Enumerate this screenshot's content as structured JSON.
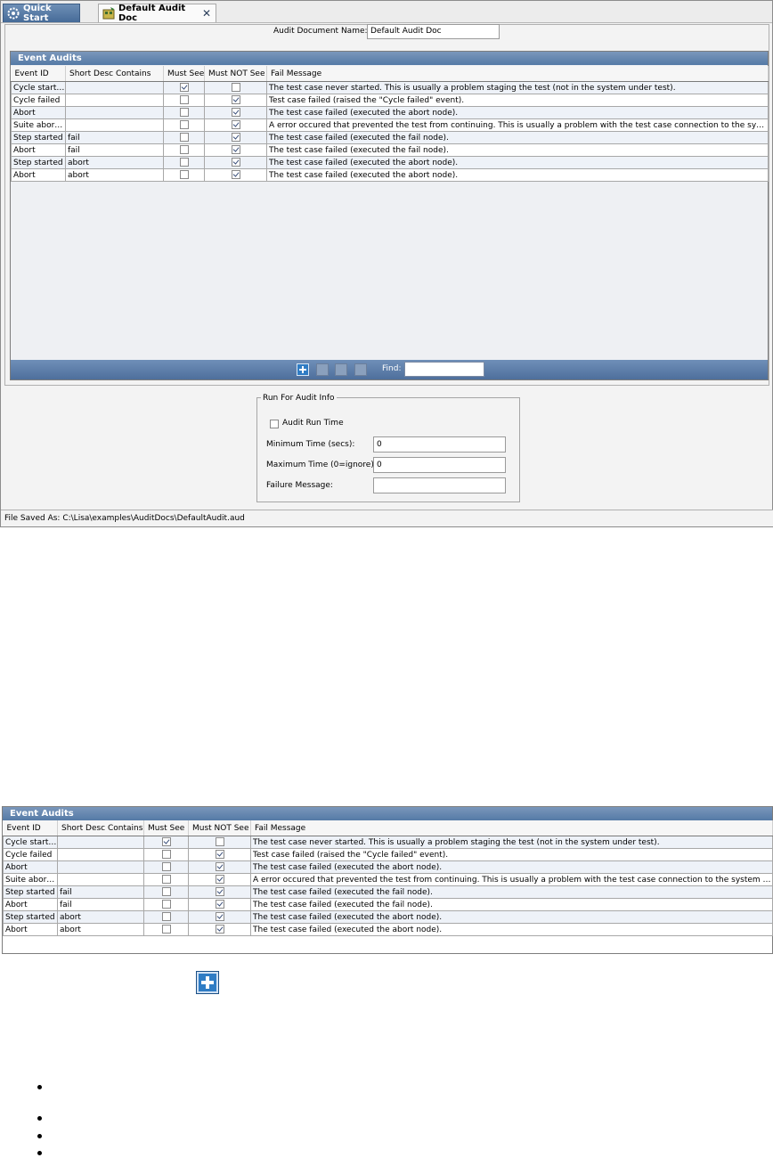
{
  "tabs": [
    {
      "label": "Quick Start"
    },
    {
      "label": "Default Audit Doc"
    }
  ],
  "doc": {
    "name_label": "Audit Document Name:",
    "name_value": "Default Audit Doc"
  },
  "event_audits": {
    "title": "Event Audits",
    "columns": [
      "Event ID",
      "Short Desc Contains",
      "Must See",
      "Must NOT See",
      "Fail Message"
    ],
    "rows": [
      {
        "event_id": "Cycle started",
        "short_desc": "",
        "must_see": true,
        "must_not_see": false,
        "fail_message": "The test case never started. This is usually a problem staging the test (not in the system under test)."
      },
      {
        "event_id": "Cycle failed",
        "short_desc": "",
        "must_see": false,
        "must_not_see": true,
        "fail_message": "Test case failed (raised the \"Cycle failed\" event)."
      },
      {
        "event_id": "Abort",
        "short_desc": "",
        "must_see": false,
        "must_not_see": true,
        "fail_message": "The test case failed (executed the abort node)."
      },
      {
        "event_id": "Suite aborted",
        "short_desc": "",
        "must_see": false,
        "must_not_see": true,
        "fail_message": "A error occured that prevented the test from continuing.  This is usually a problem with the test case connection to the system under test."
      },
      {
        "event_id": "Step started",
        "short_desc": "fail",
        "must_see": false,
        "must_not_see": true,
        "fail_message": "The test case failed (executed the fail node)."
      },
      {
        "event_id": "Abort",
        "short_desc": "fail",
        "must_see": false,
        "must_not_see": true,
        "fail_message": "The test case failed (executed the fail node)."
      },
      {
        "event_id": "Step started",
        "short_desc": "abort",
        "must_see": false,
        "must_not_see": true,
        "fail_message": "The test case failed (executed the abort node)."
      },
      {
        "event_id": "Abort",
        "short_desc": "abort",
        "must_see": false,
        "must_not_see": true,
        "fail_message": "The test case failed (executed the abort node)."
      }
    ],
    "find_label": "Find:",
    "find_value": ""
  },
  "run_for_audit": {
    "title": "Run For Audit Info",
    "audit_run_time_label": "Audit Run Time",
    "audit_run_time_checked": false,
    "min_time_label": "Minimum Time (secs):",
    "min_time_value": "0",
    "max_time_label": "Maximum Time (0=ignore):",
    "max_time_value": "0",
    "failure_message_label": "Failure Message:",
    "failure_message_value": ""
  },
  "status": {
    "text": "File Saved As: C:\\Lisa\\examples\\AuditDocs\\DefaultAudit.aud"
  },
  "icons": {
    "add": "add-icon",
    "move_up": "move-up-icon",
    "move_down": "move-down-icon",
    "delete": "delete-icon",
    "quick_start": "gear-icon",
    "audit_doc": "audit-doc-icon",
    "close": "close-icon"
  },
  "colors": {
    "header_blue": "#557aa6",
    "row_alt": "#eef2f8",
    "add_blue": "#2f7cc4"
  }
}
